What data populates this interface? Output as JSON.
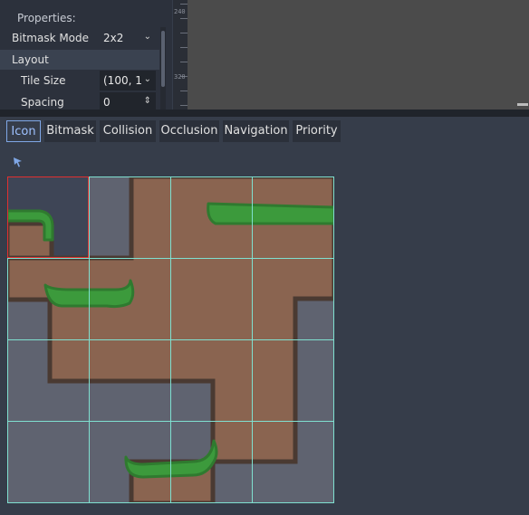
{
  "properties": {
    "title": "Properties:",
    "bitmask_mode_label": "Bitmask Mode",
    "bitmask_mode_value": "2x2",
    "layout_label": "Layout",
    "tile_size_label": "Tile Size",
    "tile_size_value": "(100, 1",
    "spacing_label": "Spacing",
    "spacing_value": "0"
  },
  "ruler": {
    "mark_1": "240",
    "mark_2": "320"
  },
  "tabs": [
    "Icon",
    "Bitmask",
    "Collision",
    "Occlusion",
    "Navigation",
    "Priority"
  ],
  "active_tab": "Icon",
  "colors": {
    "accent": "#7fa7e6",
    "grid_line": "#7fe0d0",
    "icon_selection": "#e03030",
    "dirt": "#8a6450",
    "grass": "#3c9a3c",
    "background_tile": "#5f6370"
  },
  "icons": {
    "pointer": "pointer-arrow-icon",
    "dropdown": "chevron-down-icon",
    "spin": "spinner-arrows-icon"
  }
}
